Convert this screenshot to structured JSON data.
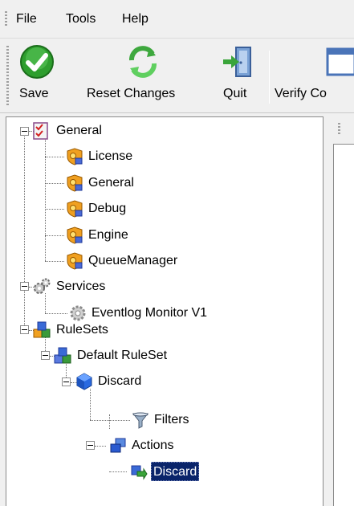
{
  "menu": {
    "items": [
      {
        "label": "File"
      },
      {
        "label": "Tools"
      },
      {
        "label": "Help"
      }
    ]
  },
  "toolbar": {
    "buttons": [
      {
        "label": "Save",
        "icon": "check-circle-icon"
      },
      {
        "label": "Reset Changes",
        "icon": "refresh-arrows-icon"
      },
      {
        "label": "Quit",
        "icon": "exit-door-icon"
      },
      {
        "label": "Verify Co",
        "icon": "verify-window-icon"
      }
    ]
  },
  "tree": {
    "nodes": [
      {
        "label": "General",
        "icon": "checklist-icon"
      },
      {
        "label": "License",
        "icon": "settings-shield-icon"
      },
      {
        "label": "General",
        "icon": "settings-shield-icon"
      },
      {
        "label": "Debug",
        "icon": "settings-shield-icon"
      },
      {
        "label": "Engine",
        "icon": "settings-shield-icon"
      },
      {
        "label": "QueueManager",
        "icon": "settings-shield-icon"
      },
      {
        "label": "Services",
        "icon": "gears-icon"
      },
      {
        "label": "Eventlog Monitor V1",
        "icon": "gear-icon"
      },
      {
        "label": "RuleSets",
        "icon": "shapes-icon"
      },
      {
        "label": "Default RuleSet",
        "icon": "shapes-icon"
      },
      {
        "label": "Discard",
        "icon": "blue-cube-icon"
      },
      {
        "label": "Filters",
        "icon": "funnel-icon"
      },
      {
        "label": "Actions",
        "icon": "windows-icon"
      },
      {
        "label": "Discard",
        "icon": "discard-action-icon",
        "selected": true
      }
    ]
  },
  "colors": {
    "selection": "#0a246a",
    "background": "#f0f0f0",
    "tree_background": "#ffffff"
  }
}
